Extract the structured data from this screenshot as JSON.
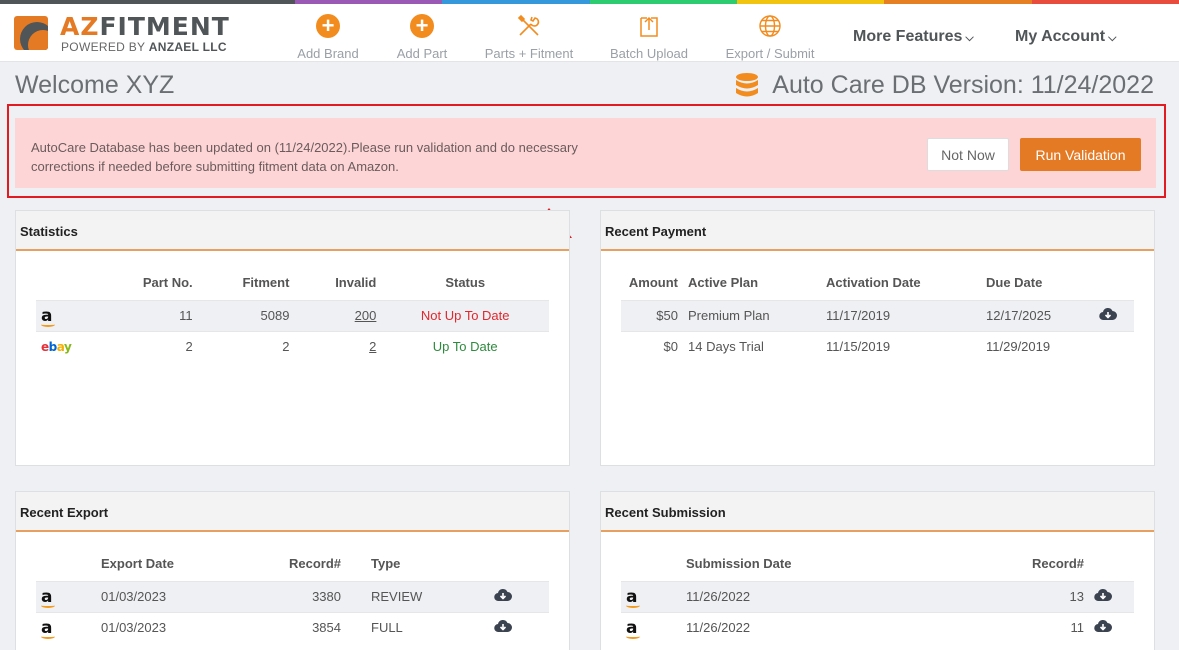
{
  "colors": {
    "accent": "#e57a25",
    "alert_bg": "#fdd5d6",
    "highlight_border": "#e21b23",
    "stripe": [
      "#505558",
      "#9b59b6",
      "#3498db",
      "#2ecc71",
      "#f1c40f",
      "#e67e22",
      "#e74c3c"
    ]
  },
  "brand": {
    "name_a": "AZ",
    "name_b": "FITMENT",
    "sub_a": "POWERED BY ",
    "sub_b": "ANZAEL LLC"
  },
  "nav": {
    "items": [
      {
        "label": "Add Brand",
        "icon": "plus-circle-icon"
      },
      {
        "label": "Add Part",
        "icon": "plus-circle-icon"
      },
      {
        "label": "Parts + Fitment",
        "icon": "tools-icon"
      },
      {
        "label": "Batch Upload",
        "icon": "upload-icon"
      },
      {
        "label": "Export / Submit",
        "icon": "globe-icon"
      }
    ],
    "more_features": "More Features",
    "my_account": "My Account"
  },
  "header": {
    "welcome": "Welcome XYZ",
    "db_version": "Auto Care DB Version: 11/24/2022"
  },
  "alert": {
    "message": "AutoCare Database has been updated on (11/24/2022).Please run validation and do necessary corrections if needed before submitting fitment data on Amazon.",
    "not_now": "Not Now",
    "run_validation": "Run Validation"
  },
  "statistics": {
    "title": "Statistics",
    "columns": [
      "Part No.",
      "Fitment",
      "Invalid",
      "Status"
    ],
    "rows": [
      {
        "marketplace": "amazon",
        "part_no": "11",
        "fitment": "5089",
        "invalid": "200",
        "status": "Not Up To Date"
      },
      {
        "marketplace": "ebay",
        "part_no": "2",
        "fitment": "2",
        "invalid": "2",
        "status": "Up To Date"
      }
    ]
  },
  "payment": {
    "title": "Recent Payment",
    "columns": [
      "Amount",
      "Active Plan",
      "Activation Date",
      "Due Date"
    ],
    "rows": [
      {
        "amount": "$50",
        "plan": "Premium Plan",
        "activation": "11/17/2019",
        "due": "12/17/2025"
      },
      {
        "amount": "$0",
        "plan": "14 Days Trial",
        "activation": "11/15/2019",
        "due": "11/29/2019"
      }
    ]
  },
  "export": {
    "title": "Recent Export",
    "columns": [
      "Export Date",
      "Record#",
      "Type"
    ],
    "rows": [
      {
        "date": "01/03/2023",
        "records": "3380",
        "type": "REVIEW"
      },
      {
        "date": "01/03/2023",
        "records": "3854",
        "type": "FULL"
      }
    ]
  },
  "submission": {
    "title": "Recent Submission",
    "columns": [
      "Submission Date",
      "Record#"
    ],
    "rows": [
      {
        "date": "11/26/2022",
        "records": "13"
      },
      {
        "date": "11/26/2022",
        "records": "11"
      }
    ]
  },
  "marketplace_logos": {
    "amazon": "a",
    "ebay_e": "e",
    "ebay_b": "b",
    "ebay_a": "a",
    "ebay_y": "y"
  }
}
